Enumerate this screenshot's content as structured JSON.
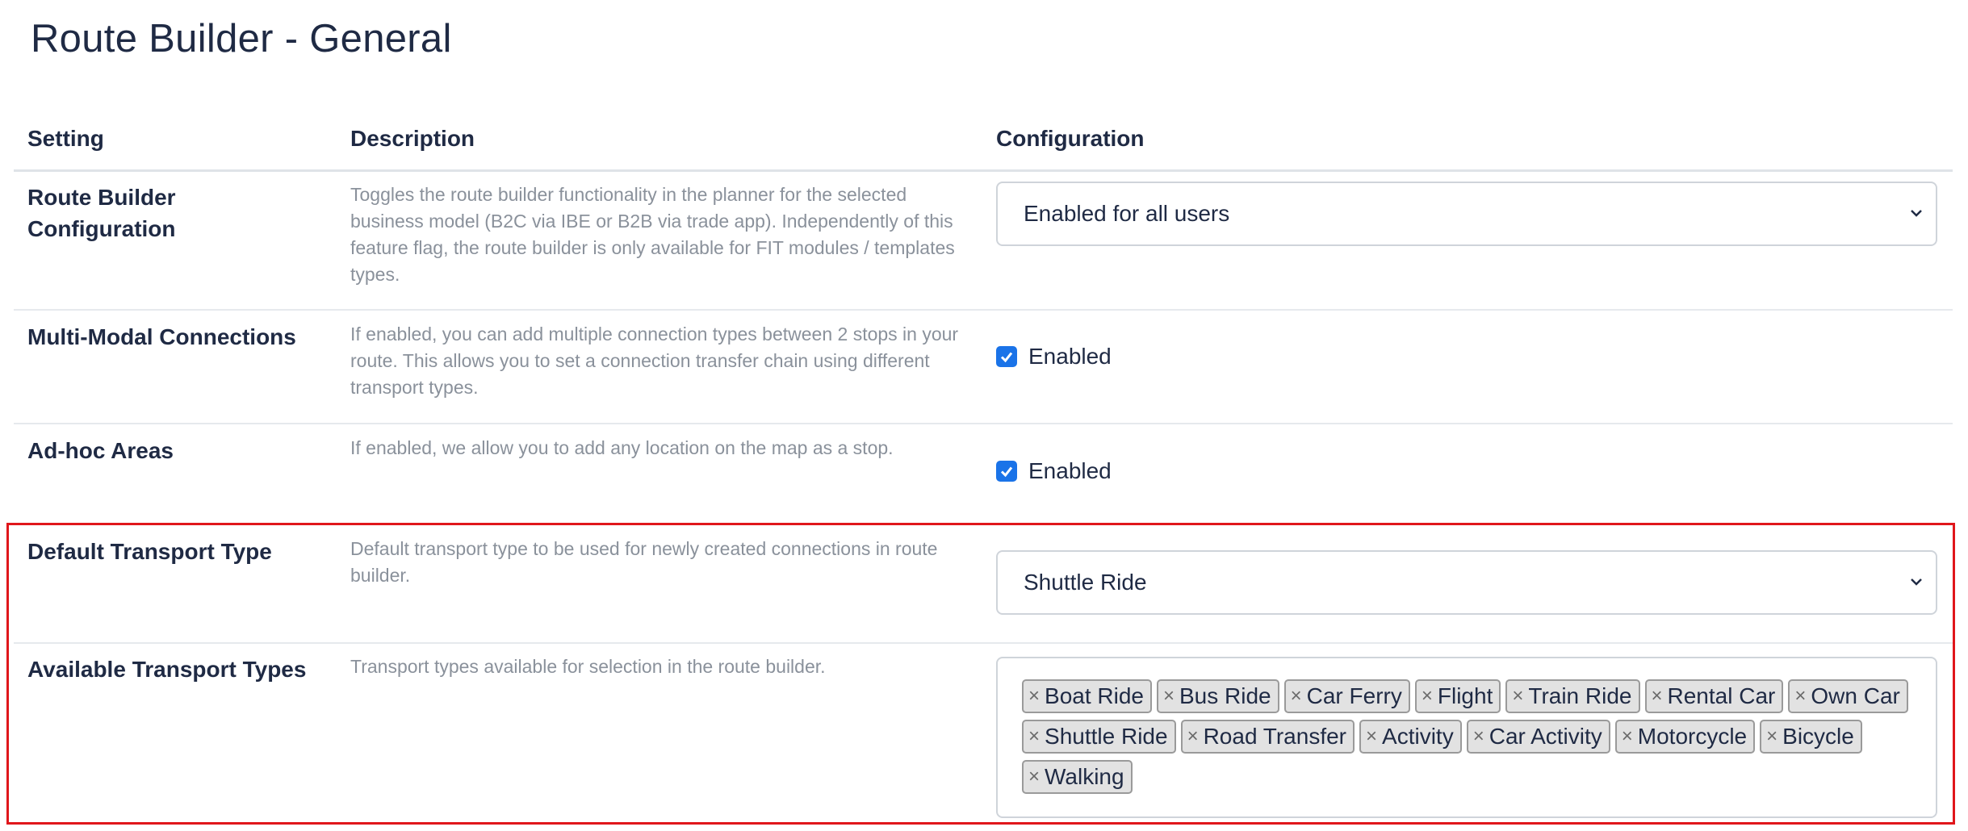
{
  "page": {
    "title": "Route Builder - General"
  },
  "table": {
    "headers": {
      "setting": "Setting",
      "description": "Description",
      "configuration": "Configuration"
    },
    "rows": [
      {
        "setting": "Route Builder Configuration",
        "description": "Toggles the route builder functionality in the planner for the selected business model (B2C via IBE or B2B via trade app). Independently of this feature flag, the route builder is only available for FIT modules / templates types.",
        "select_value": "Enabled for all users"
      },
      {
        "setting": "Multi-Modal Connections",
        "description": "If enabled, you can add multiple connection types between 2 stops in your route. This allows you to set a connection transfer chain using different transport types.",
        "checkbox_label": "Enabled",
        "checked": true
      },
      {
        "setting": "Ad-hoc Areas",
        "description": "If enabled, we allow you to add any location on the map as a stop.",
        "checkbox_label": "Enabled",
        "checked": true
      },
      {
        "setting": "Default Transport Type",
        "description": "Default transport type to be used for newly created connections in route builder.",
        "select_value": "Shuttle Ride"
      },
      {
        "setting": "Available Transport Types",
        "description": "Transport types available for selection in the route builder.",
        "tags": [
          "Boat Ride",
          "Bus Ride",
          "Car Ferry",
          "Flight",
          "Train Ride",
          "Rental Car",
          "Own Car",
          "Shuttle Ride",
          "Road Transfer",
          "Activity",
          "Car Activity",
          "Motorcycle",
          "Bicycle",
          "Walking"
        ]
      }
    ]
  },
  "icons": {
    "tag_remove": "×",
    "select_chevron": "chevron-down-icon",
    "checkbox_checked": "check-icon"
  },
  "colors": {
    "checkbox": "#1a73e8",
    "highlight": "#e0161b",
    "text": "#1f2a44",
    "muted": "#8a919b"
  }
}
